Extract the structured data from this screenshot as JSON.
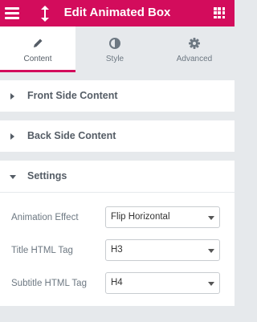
{
  "header": {
    "title": "Edit Animated Box",
    "color": "#d30c5c",
    "menu_icon": "hamburger-icon",
    "resize_icon": "vertical-resize-icon",
    "widgets_icon": "grid-icon"
  },
  "tabs": [
    {
      "label": "Content",
      "icon": "pencil-icon",
      "active": true
    },
    {
      "label": "Style",
      "icon": "contrast-icon",
      "active": false
    },
    {
      "label": "Advanced",
      "icon": "gear-icon",
      "active": false
    }
  ],
  "sections": [
    {
      "label": "Front Side Content",
      "expanded": false
    },
    {
      "label": "Back Side Content",
      "expanded": false
    },
    {
      "label": "Settings",
      "expanded": true
    }
  ],
  "settings": {
    "fields": [
      {
        "label": "Animation Effect",
        "value": "Flip Horizontal"
      },
      {
        "label": "Title HTML Tag",
        "value": "H3"
      },
      {
        "label": "Subtitle HTML Tag",
        "value": "H4"
      }
    ]
  }
}
